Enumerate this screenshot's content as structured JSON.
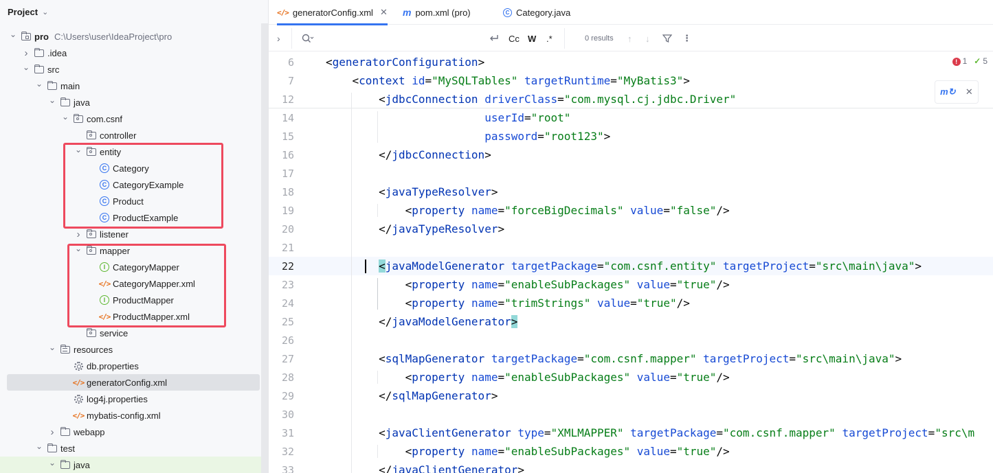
{
  "project_panel": {
    "title": "Project",
    "tree": [
      {
        "label": "pro",
        "path": "C:\\Users\\user\\IdeaProject\\pro",
        "icon": "module-folder-icon",
        "expanded": true
      },
      {
        "label": ".idea",
        "icon": "folder-icon",
        "expanded": false
      },
      {
        "label": "src",
        "icon": "folder-icon",
        "expanded": true
      },
      {
        "label": "main",
        "icon": "folder-icon",
        "expanded": true
      },
      {
        "label": "java",
        "icon": "source-folder-icon",
        "expanded": true
      },
      {
        "label": "com.csnf",
        "icon": "package-icon",
        "expanded": true
      },
      {
        "label": "controller",
        "icon": "package-icon"
      },
      {
        "label": "entity",
        "icon": "package-icon",
        "expanded": true
      },
      {
        "label": "Category",
        "icon": "class-icon"
      },
      {
        "label": "CategoryExample",
        "icon": "class-icon"
      },
      {
        "label": "Product",
        "icon": "class-icon"
      },
      {
        "label": "ProductExample",
        "icon": "class-icon"
      },
      {
        "label": "listener",
        "icon": "package-icon",
        "expanded": false
      },
      {
        "label": "mapper",
        "icon": "package-icon",
        "expanded": true
      },
      {
        "label": "CategoryMapper",
        "icon": "interface-icon"
      },
      {
        "label": "CategoryMapper.xml",
        "icon": "xml-file-icon"
      },
      {
        "label": "ProductMapper",
        "icon": "interface-icon"
      },
      {
        "label": "ProductMapper.xml",
        "icon": "xml-file-icon"
      },
      {
        "label": "service",
        "icon": "package-icon"
      },
      {
        "label": "resources",
        "icon": "resources-folder-icon",
        "expanded": true
      },
      {
        "label": "db.properties",
        "icon": "properties-file-icon"
      },
      {
        "label": "generatorConfig.xml",
        "icon": "xml-file-icon",
        "selected": true
      },
      {
        "label": "log4j.properties",
        "icon": "properties-file-icon"
      },
      {
        "label": "mybatis-config.xml",
        "icon": "xml-file-icon"
      },
      {
        "label": "webapp",
        "icon": "folder-icon",
        "expanded": false
      },
      {
        "label": "test",
        "icon": "folder-icon",
        "expanded": true
      },
      {
        "label": "java",
        "icon": "test-source-folder-icon",
        "expanded": true
      }
    ]
  },
  "tabs": [
    {
      "label": "generatorConfig.xml",
      "icon": "xml-file-icon",
      "active": true
    },
    {
      "label": "pom.xml (pro)",
      "icon": "maven-icon"
    },
    {
      "label": "Category.java",
      "icon": "class-icon"
    }
  ],
  "search": {
    "placeholder": "",
    "case_label": "Cc",
    "word_label": "W",
    "regex_label": ".*",
    "results": "0 results"
  },
  "inspections": {
    "errors": "1",
    "warnings": "5"
  },
  "code": {
    "lines": [
      {
        "num": "6",
        "text": "<generatorConfiguration>"
      },
      {
        "num": "7",
        "text": "    <context id=\"MySQLTables\" targetRuntime=\"MyBatis3\">"
      },
      {
        "num": "12",
        "text": "        <jdbcConnection driverClass=\"com.mysql.cj.jdbc.Driver\""
      },
      {
        "num": "14",
        "text": "                        userId=\"root\""
      },
      {
        "num": "15",
        "text": "                        password=\"root123\">"
      },
      {
        "num": "16",
        "text": "        </jdbcConnection>"
      },
      {
        "num": "17",
        "text": ""
      },
      {
        "num": "18",
        "text": "        <javaTypeResolver>"
      },
      {
        "num": "19",
        "text": "            <property name=\"forceBigDecimals\" value=\"false\"/>"
      },
      {
        "num": "20",
        "text": "        </javaTypeResolver>"
      },
      {
        "num": "21",
        "text": ""
      },
      {
        "num": "22",
        "text": "        <javaModelGenerator targetPackage=\"com.csnf.entity\" targetProject=\"src\\main\\java\">"
      },
      {
        "num": "23",
        "text": "            <property name=\"enableSubPackages\" value=\"true\"/>"
      },
      {
        "num": "24",
        "text": "            <property name=\"trimStrings\" value=\"true\"/>"
      },
      {
        "num": "25",
        "text": "        </javaModelGenerator>"
      },
      {
        "num": "26",
        "text": ""
      },
      {
        "num": "27",
        "text": "        <sqlMapGenerator targetPackage=\"com.csnf.mapper\" targetProject=\"src\\main\\java\">"
      },
      {
        "num": "28",
        "text": "            <property name=\"enableSubPackages\" value=\"true\"/>"
      },
      {
        "num": "29",
        "text": "        </sqlMapGenerator>"
      },
      {
        "num": "30",
        "text": ""
      },
      {
        "num": "31",
        "text": "        <javaClientGenerator type=\"XMLMAPPER\" targetPackage=\"com.csnf.mapper\" targetProject=\"src\\m"
      },
      {
        "num": "32",
        "text": "            <property name=\"enableSubPackages\" value=\"true\"/>"
      },
      {
        "num": "33",
        "text": "        </javaClientGenerator>"
      }
    ],
    "current_line": "22"
  },
  "colors": {
    "tag": "#0033b3",
    "attribute": "#174ad4",
    "value": "#067d17",
    "annotation_box": "#ee4a5e",
    "accent": "#3574f0"
  }
}
